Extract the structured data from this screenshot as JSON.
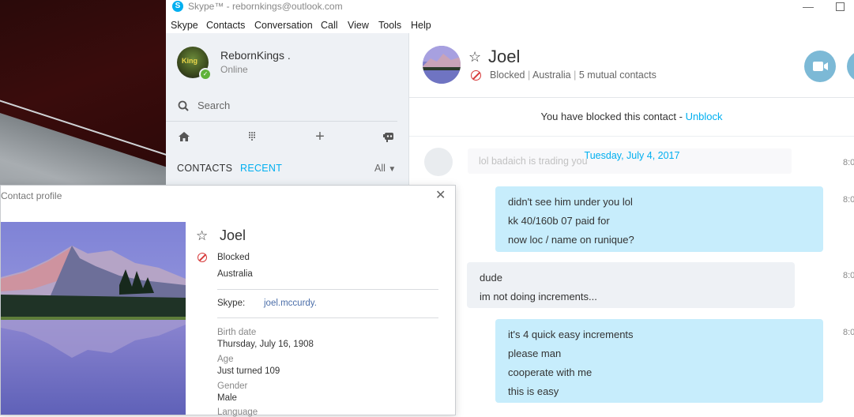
{
  "window": {
    "title": "Skype™ - rebornkings@outlook.com",
    "logo_letter": "S"
  },
  "menu": [
    "Skype",
    "Contacts",
    "Conversation",
    "Call",
    "View",
    "Tools",
    "Help"
  ],
  "user": {
    "name": "RebornKings .",
    "status": "Online",
    "avatar_text": "King"
  },
  "search": {
    "label": "Search"
  },
  "contacts_tabs": {
    "contacts": "CONTACTS",
    "recent": "RECENT",
    "filter": "All"
  },
  "conversation": {
    "name": "Joel",
    "status": "Blocked",
    "country": "Australia",
    "mutual": "5 mutual contacts",
    "blocked_notice": "You have blocked this contact - ",
    "unblock": "Unblock",
    "date": "Tuesday, July 4, 2017",
    "faded_message": "lol badaich is trading you",
    "time_label": "8:0",
    "messages": [
      {
        "direction": "out",
        "lines": [
          "didn't see him under you lol",
          "kk 40/160b 07 paid for",
          "now loc / name on runique?"
        ]
      },
      {
        "direction": "in",
        "lines": [
          "dude",
          "im not doing increments..."
        ]
      },
      {
        "direction": "out",
        "lines": [
          "it's 4 quick easy increments",
          "please man",
          "cooperate with me",
          "this is easy"
        ]
      }
    ]
  },
  "profile": {
    "title": "Contact profile",
    "name": "Joel",
    "blocked": "Blocked",
    "country": "Australia",
    "skype_label": "Skype:",
    "skype_value": "joel.mccurdy.",
    "birth_label": "Birth date",
    "birth_value": "Thursday, July 16, 1908",
    "age_label": "Age",
    "age_value": "Just turned 109",
    "gender_label": "Gender",
    "gender_value": "Male",
    "language_label": "Language"
  },
  "colors": {
    "accent": "#00aff0",
    "bubble_out": "#c7edfc",
    "bubble_in": "#eef1f5",
    "blocked_red": "#d73b3b",
    "online_green": "#5fb23a"
  }
}
